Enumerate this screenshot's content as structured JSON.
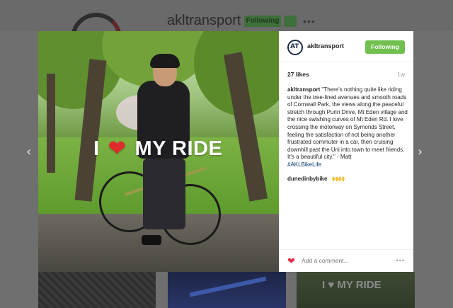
{
  "background_profile": {
    "username": "akltransport",
    "follow_button_label": "Following",
    "more_label": "•••",
    "tile_text": "I ♥ MY RIDE"
  },
  "post": {
    "photo_overlay_text": {
      "before": "I",
      "heart": "❤",
      "after": "MY RIDE"
    },
    "header": {
      "avatar_text": "AT",
      "username": "akltransport",
      "following_label": "Following"
    },
    "likes": "27 likes",
    "age": "1w",
    "caption": {
      "username": "akltransport",
      "text": "\"There's nothing quite like riding under the tree-lined avenues and smooth roads of Cornwall Park, the views along the peaceful stretch through Puriri Drive, Mt Eden village and the nice swishing curves of Mt Eden Rd. I love crossing the motorway on Symonds Street, feeling the satisfaction of not being another frustrated commuter in a car, then cruising downhill past the Uni into town to meet friends. It's a beautiful city.\" - Matt",
      "hashtag": "#AKLBikeLife"
    },
    "comment": {
      "username": "dunedinbybike",
      "emoji": "🙌🙌"
    },
    "footer": {
      "like_icon": "❤",
      "add_comment_placeholder": "Add a comment...",
      "more_label": "•••"
    }
  },
  "nav": {
    "prev_glyph": "‹",
    "next_glyph": "›"
  },
  "colors": {
    "following_green": "#70c050",
    "heart_red": "#e0334e",
    "hashtag_blue": "#003569",
    "overlay_heart": "#e02b2b"
  }
}
